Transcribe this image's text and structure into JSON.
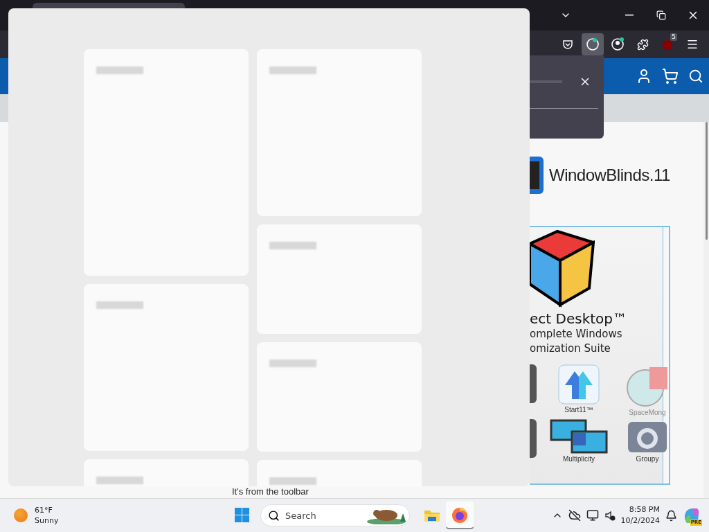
{
  "browser": {
    "extension_badge": "5"
  },
  "site": {
    "logo_text": "WindowBlinds.11",
    "ad": {
      "title": "ect Desktop™",
      "subtitle_lines": [
        "omplete Windows",
        "omization Suite"
      ],
      "apps": [
        {
          "kind": "cut"
        },
        {
          "kind": "start",
          "label": "Start11™"
        },
        {
          "kind": "space",
          "label": "SpaceMong"
        },
        {
          "kind": "cut"
        },
        {
          "kind": "multi",
          "label": "Multiplicity"
        },
        {
          "kind": "groupy",
          "label": "Groupy"
        }
      ]
    },
    "snippet": "It's from the toolbar"
  },
  "widgets": {
    "columns": [
      {
        "cards": [
          {
            "kind": "tall"
          },
          {
            "kind": "medium"
          },
          {
            "kind": "partial"
          }
        ]
      },
      {
        "cards": [
          {
            "kind": "medium"
          },
          {
            "kind": "short"
          },
          {
            "kind": "short"
          },
          {
            "kind": "partial"
          }
        ]
      }
    ]
  },
  "taskbar": {
    "weather": {
      "temp": "61°F",
      "condition": "Sunny"
    },
    "search": {
      "label": "Search"
    },
    "apps": [
      {
        "kind": "files",
        "selected": false
      },
      {
        "kind": "browser",
        "selected": true
      }
    ],
    "clock": {
      "time": "8:58 PM",
      "date": "10/2/2024"
    },
    "copilot_badge": "PRE"
  }
}
